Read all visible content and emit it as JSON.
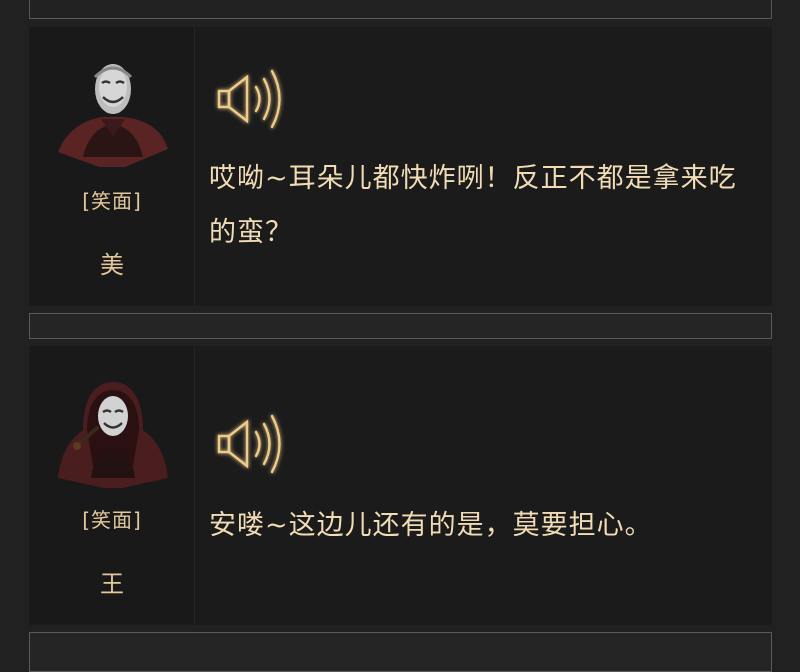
{
  "dialogues": [
    {
      "tag": "[笑面]",
      "name": "美",
      "text": "哎呦~耳朵儿都快炸咧！反正不都是拿来吃的蛮？",
      "portrait_icon": "masked-figure-portrait-icon"
    },
    {
      "tag": "[笑面]",
      "name": "王",
      "text": "安喽~这边儿还有的是，莫要担心。",
      "portrait_icon": "hooded-masked-figure-portrait-icon"
    }
  ],
  "audio_icon": "speaker-volume-icon",
  "colors": {
    "text": "#f1dcb5",
    "label": "#e3c89b",
    "card_bg": "#1a1a1a",
    "page_bg": "#212121"
  }
}
